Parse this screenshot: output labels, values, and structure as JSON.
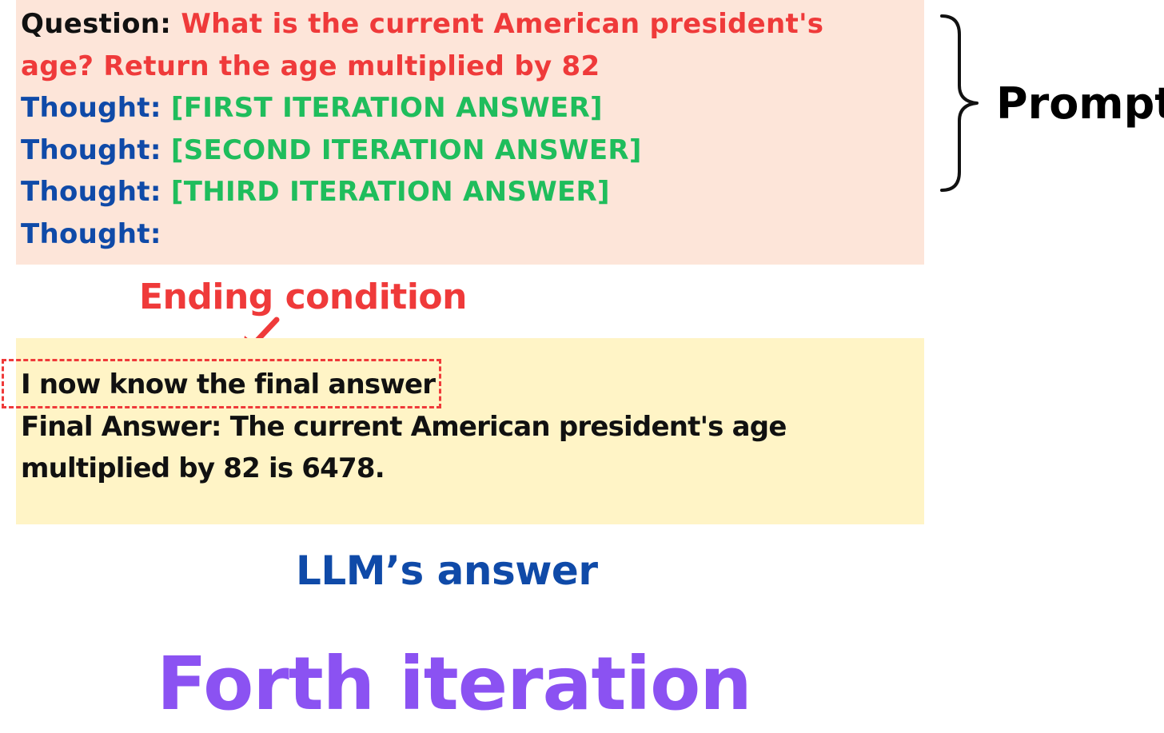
{
  "prompt_box": {
    "question_label": "Question:",
    "question_text_line1": "What is the current American president's",
    "question_text_line2": "age? Return the age multiplied by 82",
    "thoughts": [
      {
        "label": "Thought:",
        "value": "[FIRST ITERATION ANSWER]"
      },
      {
        "label": "Thought:",
        "value": "[SECOND ITERATION ANSWER]"
      },
      {
        "label": "Thought:",
        "value": "[THIRD ITERATION ANSWER]"
      },
      {
        "label": "Thought:",
        "value": ""
      }
    ],
    "side_label": "Prompt"
  },
  "ending_condition": {
    "label": "Ending condition"
  },
  "answer_box": {
    "highlighted_line": "I now know the final answer",
    "final_line1": "Final Answer: The current American president's age",
    "final_line2": "multiplied by 82 is 6478.",
    "caption": "LLM’s answer"
  },
  "title": "Forth iteration",
  "colors": {
    "prompt_bg": "#fde5d9",
    "answer_bg": "#fff4c6",
    "red": "#ef3a3a",
    "blue": "#0f4aa8",
    "green": "#1fbd5c",
    "purple": "#8b52f2"
  },
  "icons": {
    "brace": "right-curly-brace-icon",
    "arrow": "arrow-down-left-icon"
  }
}
